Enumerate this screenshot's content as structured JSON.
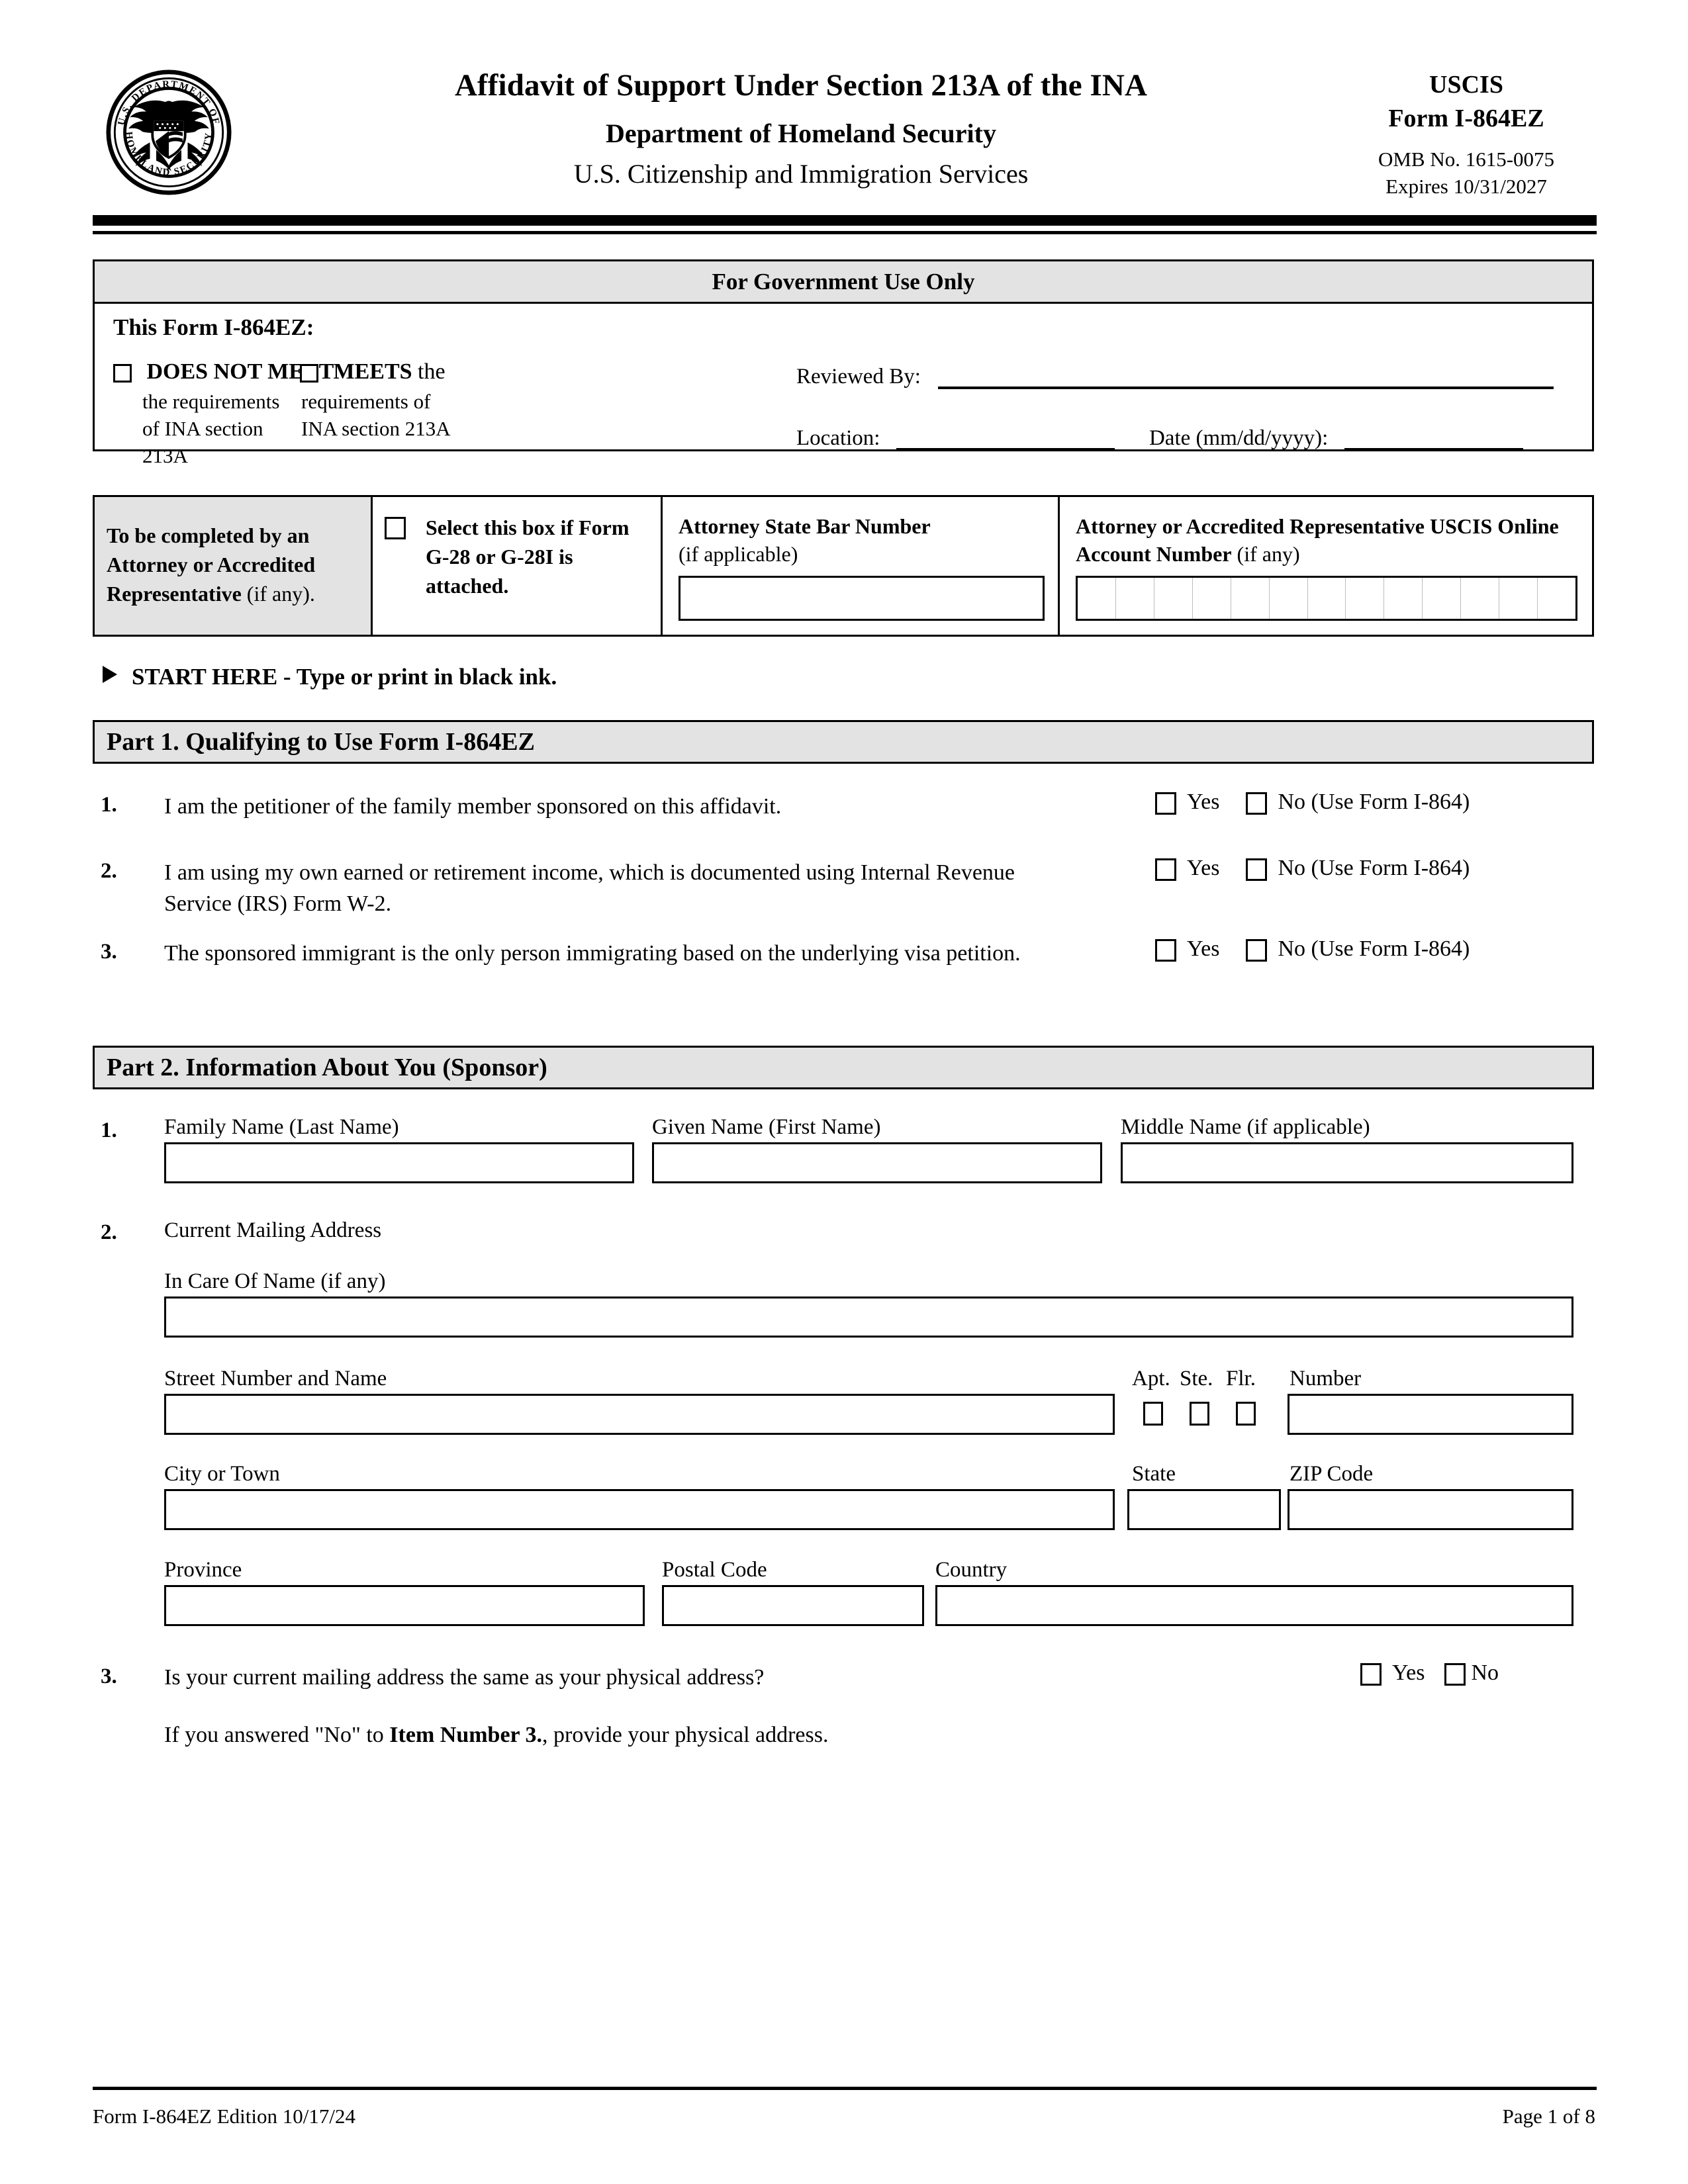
{
  "header": {
    "title": "Affidavit of Support Under Section 213A of the INA",
    "department": "Department of Homeland Security",
    "agency": "U.S. Citizenship and Immigration Services",
    "agency_short": "USCIS",
    "form_number": "Form I-864EZ",
    "omb": "OMB No. 1615-0075",
    "expires": "Expires 10/31/2027",
    "seal_alt": "U.S. Department of Homeland Security Seal"
  },
  "government_use": {
    "heading": "For Government Use Only",
    "form_label": "This Form I-864EZ:",
    "option_does_not_meet_bold": "DOES NOT MEET",
    "option_does_not_meet_body": "the requirements of INA section 213A",
    "option_meets_bold": "MEETS",
    "option_meets_bold_tail": "the",
    "option_meets_body": "requirements of INA section 213A",
    "reviewed_by_label": "Reviewed By:",
    "location_label": "Location:",
    "date_label": "Date (mm/dd/yyyy):"
  },
  "attorney": {
    "col1_bold": "To be completed by an Attorney or Accredited Representative",
    "col1_light": " (if any).",
    "checkbox_text": "Select this box if Form G-28 or G-28I is attached.",
    "bar_number_label": "Attorney State Bar Number",
    "bar_number_note": "(if applicable)",
    "online_account_label": "Attorney or Accredited Representative USCIS Online Account Number",
    "online_account_note": " (if any)",
    "online_account_cells": 13
  },
  "start_here": "START HERE - Type or print in black ink.",
  "part1": {
    "heading": "Part 1.  Qualifying to Use Form I-864EZ",
    "items": [
      {
        "number": "1.",
        "text": "I am the petitioner of the family member sponsored on this affidavit.",
        "yes_label": "Yes",
        "no_label": "No (Use Form I-864)"
      },
      {
        "number": "2.",
        "text": "I am using my own earned or retirement income, which is documented using Internal Revenue Service (IRS) Form W-2.",
        "yes_label": "Yes",
        "no_label": "No (Use Form I-864)"
      },
      {
        "number": "3.",
        "text": "The sponsored immigrant is the only person immigrating based on the underlying visa petition.",
        "yes_label": "Yes",
        "no_label": "No (Use Form I-864)"
      }
    ]
  },
  "part2": {
    "heading": "Part 2.  Information About You (Sponsor)",
    "item1": {
      "number": "1.",
      "family_name_label": "Family Name (Last Name)",
      "given_name_label": "Given Name (First Name)",
      "middle_name_label": "Middle Name (if applicable)",
      "family_name_value": "",
      "given_name_value": "",
      "middle_name_value": ""
    },
    "item2": {
      "number": "2.",
      "heading": "Current Mailing Address",
      "in_care_of_label": "In Care Of Name (if any)",
      "street_label": "Street Number and Name",
      "apt_label": "Apt.",
      "ste_label": "Ste.",
      "flr_label": "Flr.",
      "number_label": "Number",
      "city_label": "City or Town",
      "state_label": "State",
      "zip_label": "ZIP Code",
      "province_label": "Province",
      "postal_code_label": "Postal Code",
      "country_label": "Country"
    },
    "item3": {
      "number": "3.",
      "text": "Is your current mailing address the same as your physical address?",
      "yes_label": "Yes",
      "no_label": "No",
      "note_prefix": "If you answered \"No\" to ",
      "note_bold": "Item Number 3.",
      "note_suffix": ", provide your physical address."
    }
  },
  "footer": {
    "left": "Form I-864EZ   Edition   10/17/24",
    "right": "Page 1 of 8"
  },
  "colors": {
    "shade": "#e3e3e3",
    "ink": "#000000",
    "paper": "#ffffff"
  }
}
